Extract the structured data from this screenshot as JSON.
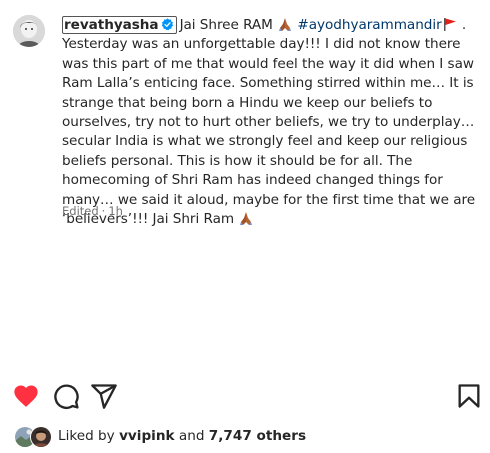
{
  "post": {
    "username": "revathyasha",
    "caption_head": "Jai Shree RAM",
    "hashtag": "#ayodhyarammandir",
    "caption_body": "Yesterday was an unforgettable day!!! I did not know there was this part of me that would feel the way it did when I saw Ram Lalla’s enticing face. Something stirred within me… It is strange that being born a Hindu we keep our beliefs to ourselves, try not to hurt other beliefs, we try to underplay… secular India is what we strongly feel and keep our religious beliefs personal. This is how it should be for all. The homecoming of Shri Ram has indeed changed things for many… we said it aloud, maybe for the first time that we are ‘believers’!!! Jai Shri Ram",
    "edited_label": "Edited",
    "separator": "·",
    "time_ago": "1h"
  },
  "likes": {
    "prefix": "Liked by",
    "first_user": "vvipink",
    "connector": "and",
    "others": "7,747 others"
  },
  "colors": {
    "heart": "#ff3040",
    "verified": "#0095f6",
    "hashtag": "#00376b",
    "meta": "#737373"
  },
  "icons": {
    "like": "heart-filled-icon",
    "comment": "comment-bubble-icon",
    "share": "paper-plane-icon",
    "save": "bookmark-icon",
    "verified": "verified-badge-icon",
    "prayer": "folded-hands-emoji",
    "flag": "red-flag-emoji"
  }
}
